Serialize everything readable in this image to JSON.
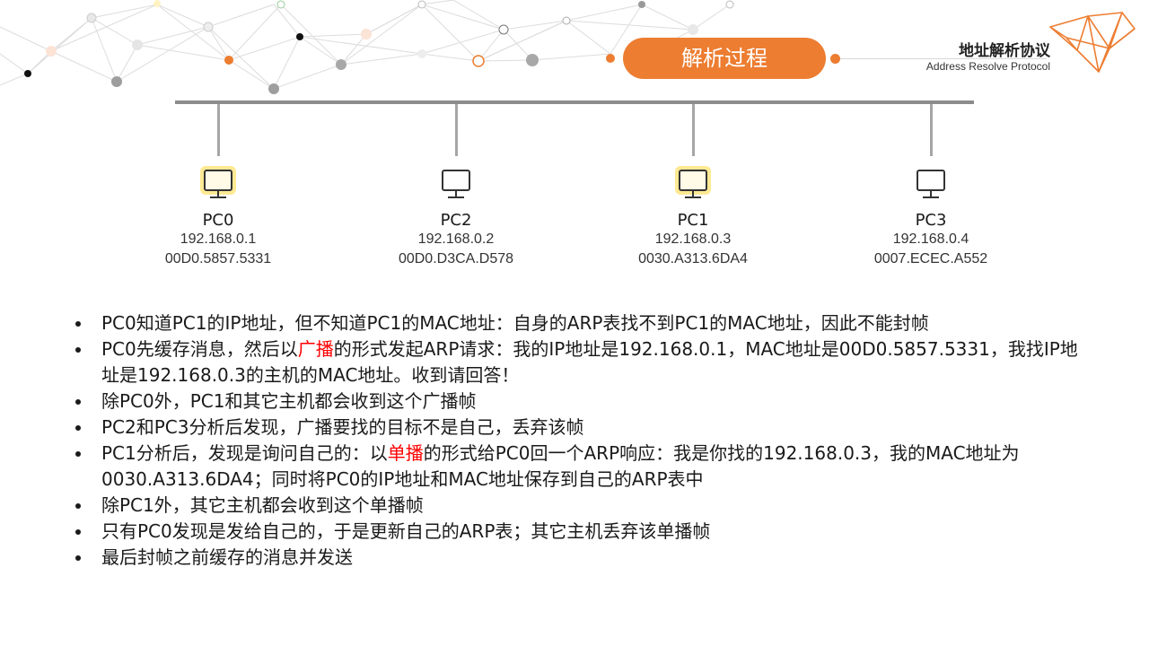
{
  "header": {
    "title": "解析过程",
    "brand_title": "地址解析协议",
    "brand_subtitle": "Address Resolve Protocol"
  },
  "colors": {
    "accent": "#ED7D31",
    "highlight": "#FF0000",
    "bus": "#8C8C8C"
  },
  "hosts": [
    {
      "name": "PC0",
      "ip": "192.168.0.1",
      "mac": "00D0.5857.5331",
      "icon": "monitor-icon",
      "highlighted": true
    },
    {
      "name": "PC2",
      "ip": "192.168.0.2",
      "mac": "00D0.D3CA.D578",
      "icon": "monitor-icon",
      "highlighted": false
    },
    {
      "name": "PC1",
      "ip": "192.168.0.3",
      "mac": "0030.A313.6DA4",
      "icon": "monitor-icon",
      "highlighted": true
    },
    {
      "name": "PC3",
      "ip": "192.168.0.4",
      "mac": "0007.ECEC.A552",
      "icon": "monitor-icon",
      "highlighted": false
    }
  ],
  "bullets": [
    {
      "pre": "PC0知道PC1的IP地址，但不知道PC1的MAC地址：自身的ARP表找不到PC1的MAC地址，因此不能封帧",
      "hl": "",
      "post": ""
    },
    {
      "pre": "PC0先缓存消息，然后以",
      "hl": "广播",
      "post": "的形式发起ARP请求：我的IP地址是192.168.0.1，MAC地址是00D0.5857.5331，我找IP地址是192.168.0.3的主机的MAC地址。收到请回答！"
    },
    {
      "pre": "除PC0外，PC1和其它主机都会收到这个广播帧",
      "hl": "",
      "post": ""
    },
    {
      "pre": "PC2和PC3分析后发现，广播要找的目标不是自己，丢弃该帧",
      "hl": "",
      "post": ""
    },
    {
      "pre": "PC1分析后，发现是询问自己的：以",
      "hl": "单播",
      "post": "的形式给PC0回一个ARP响应：我是你找的192.168.0.3，我的MAC地址为0030.A313.6DA4；同时将PC0的IP地址和MAC地址保存到自己的ARP表中"
    },
    {
      "pre": "除PC1外，其它主机都会收到这个单播帧",
      "hl": "",
      "post": ""
    },
    {
      "pre": "只有PC0发现是发给自己的，于是更新自己的ARP表；其它主机丢弃该单播帧",
      "hl": "",
      "post": ""
    },
    {
      "pre": "最后封帧之前缓存的消息并发送",
      "hl": "",
      "post": ""
    }
  ]
}
